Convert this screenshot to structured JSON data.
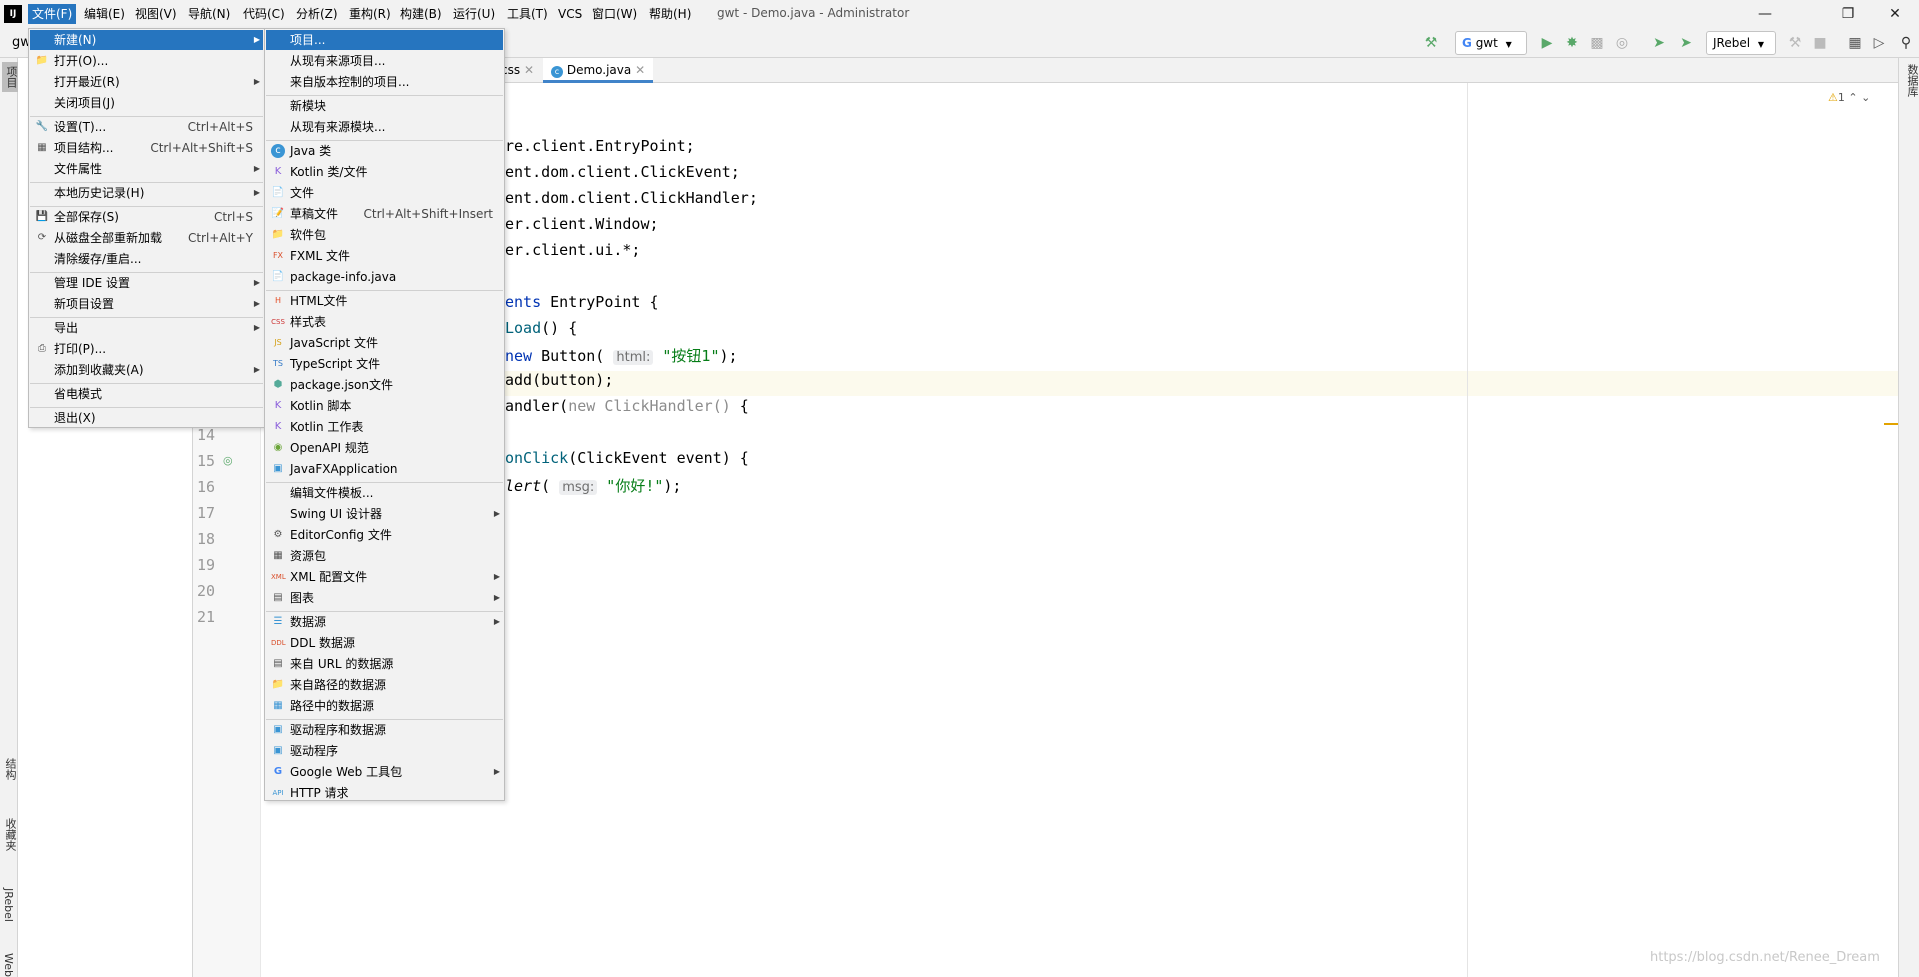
{
  "app": {
    "logo": "IJ",
    "window_title": "gwt - Demo.java - Administrator"
  },
  "menubar": [
    "文件(F)",
    "编辑(E)",
    "视图(V)",
    "导航(N)",
    "代码(C)",
    "分析(Z)",
    "重构(R)",
    "构建(B)",
    "运行(U)",
    "工具(T)",
    "VCS",
    "窗口(W)",
    "帮助(H)"
  ],
  "toolbar": {
    "project_crumb": "gw",
    "run_config": "gwt",
    "jrebel": "JRebel"
  },
  "tabs": [
    {
      "label": "css"
    },
    {
      "label": "Demo.java"
    }
  ],
  "inspection": {
    "count": "1"
  },
  "side": {
    "project": "项目",
    "structure": "结构",
    "favorites": "收藏夹",
    "jrebel": "JRebel",
    "web": "Web",
    "database": "数据库"
  },
  "gutter_lines": [
    "14",
    "15",
    "16",
    "17",
    "18",
    "19",
    "20",
    "21"
  ],
  "code": {
    "l1": "re.client.EntryPoint;",
    "l2": "ent.dom.client.ClickEvent;",
    "l3": "ent.dom.client.ClickHandler;",
    "l4": "er.client.Window;",
    "l5": "er.client.ui.*;",
    "l6a": "ents",
    "l6b": " EntryPoint {",
    "l7a": "Load",
    "l7b": "() {",
    "l8a": "new",
    "l8b": " Button( ",
    "l8hint": "html:",
    "l8str": "\"按钮1\"",
    "l8c": ");",
    "l9": "add(button);",
    "l10a": "andler(",
    "l10b": "new ClickHandler()",
    "l10c": " {",
    "l11a": "onClick",
    "l11b": "(ClickEvent event) {",
    "l12a": "lert",
    "l12b": "( ",
    "l12hint": "msg:",
    "l12str": "\"你好!\"",
    "l12c": ");"
  },
  "file_menu": [
    {
      "label": "新建(N)",
      "arrow": true
    },
    {
      "label": "打开(O)..."
    },
    {
      "label": "打开最近(R)",
      "arrow": true
    },
    {
      "label": "关闭项目(J)"
    },
    {
      "label": "设置(T)...",
      "shortcut": "Ctrl+Alt+S"
    },
    {
      "label": "项目结构...",
      "shortcut": "Ctrl+Alt+Shift+S"
    },
    {
      "label": "文件属性",
      "arrow": true
    },
    {
      "label": "本地历史记录(H)",
      "arrow": true
    },
    {
      "label": "全部保存(S)",
      "shortcut": "Ctrl+S"
    },
    {
      "label": "从磁盘全部重新加载",
      "shortcut": "Ctrl+Alt+Y"
    },
    {
      "label": "清除缓存/重启..."
    },
    {
      "label": "管理 IDE 设置",
      "arrow": true
    },
    {
      "label": "新项目设置",
      "arrow": true
    },
    {
      "label": "导出",
      "arrow": true
    },
    {
      "label": "打印(P)..."
    },
    {
      "label": "添加到收藏夹(A)",
      "arrow": true
    },
    {
      "label": "省电模式"
    },
    {
      "label": "退出(X)"
    }
  ],
  "new_menu": [
    {
      "label": "项目..."
    },
    {
      "label": "从现有来源项目..."
    },
    {
      "label": "来自版本控制的项目..."
    },
    {
      "label": "新模块"
    },
    {
      "label": "从现有来源模块..."
    },
    {
      "label": "Java 类"
    },
    {
      "label": "Kotlin 类/文件"
    },
    {
      "label": "文件"
    },
    {
      "label": "草稿文件",
      "shortcut": "Ctrl+Alt+Shift+Insert"
    },
    {
      "label": "软件包"
    },
    {
      "label": "FXML 文件"
    },
    {
      "label": "package-info.java"
    },
    {
      "label": "HTML文件"
    },
    {
      "label": "样式表"
    },
    {
      "label": "JavaScript 文件"
    },
    {
      "label": "TypeScript 文件"
    },
    {
      "label": "package.json文件"
    },
    {
      "label": "Kotlin 脚本"
    },
    {
      "label": "Kotlin 工作表"
    },
    {
      "label": "OpenAPI 规范"
    },
    {
      "label": "JavaFXApplication"
    },
    {
      "label": "编辑文件模板..."
    },
    {
      "label": "Swing UI 设计器",
      "arrow": true
    },
    {
      "label": "EditorConfig 文件"
    },
    {
      "label": "资源包"
    },
    {
      "label": "XML 配置文件",
      "arrow": true
    },
    {
      "label": "图表",
      "arrow": true
    },
    {
      "label": "数据源",
      "arrow": true
    },
    {
      "label": "DDL 数据源"
    },
    {
      "label": "来自 URL 的数据源"
    },
    {
      "label": "来自路径的数据源"
    },
    {
      "label": "路径中的数据源"
    },
    {
      "label": "驱动程序和数据源"
    },
    {
      "label": "驱动程序"
    },
    {
      "label": "Google Web 工具包",
      "arrow": true
    },
    {
      "label": "HTTP 请求"
    }
  ],
  "watermark": "https://blog.csdn.net/Renee_Dream"
}
